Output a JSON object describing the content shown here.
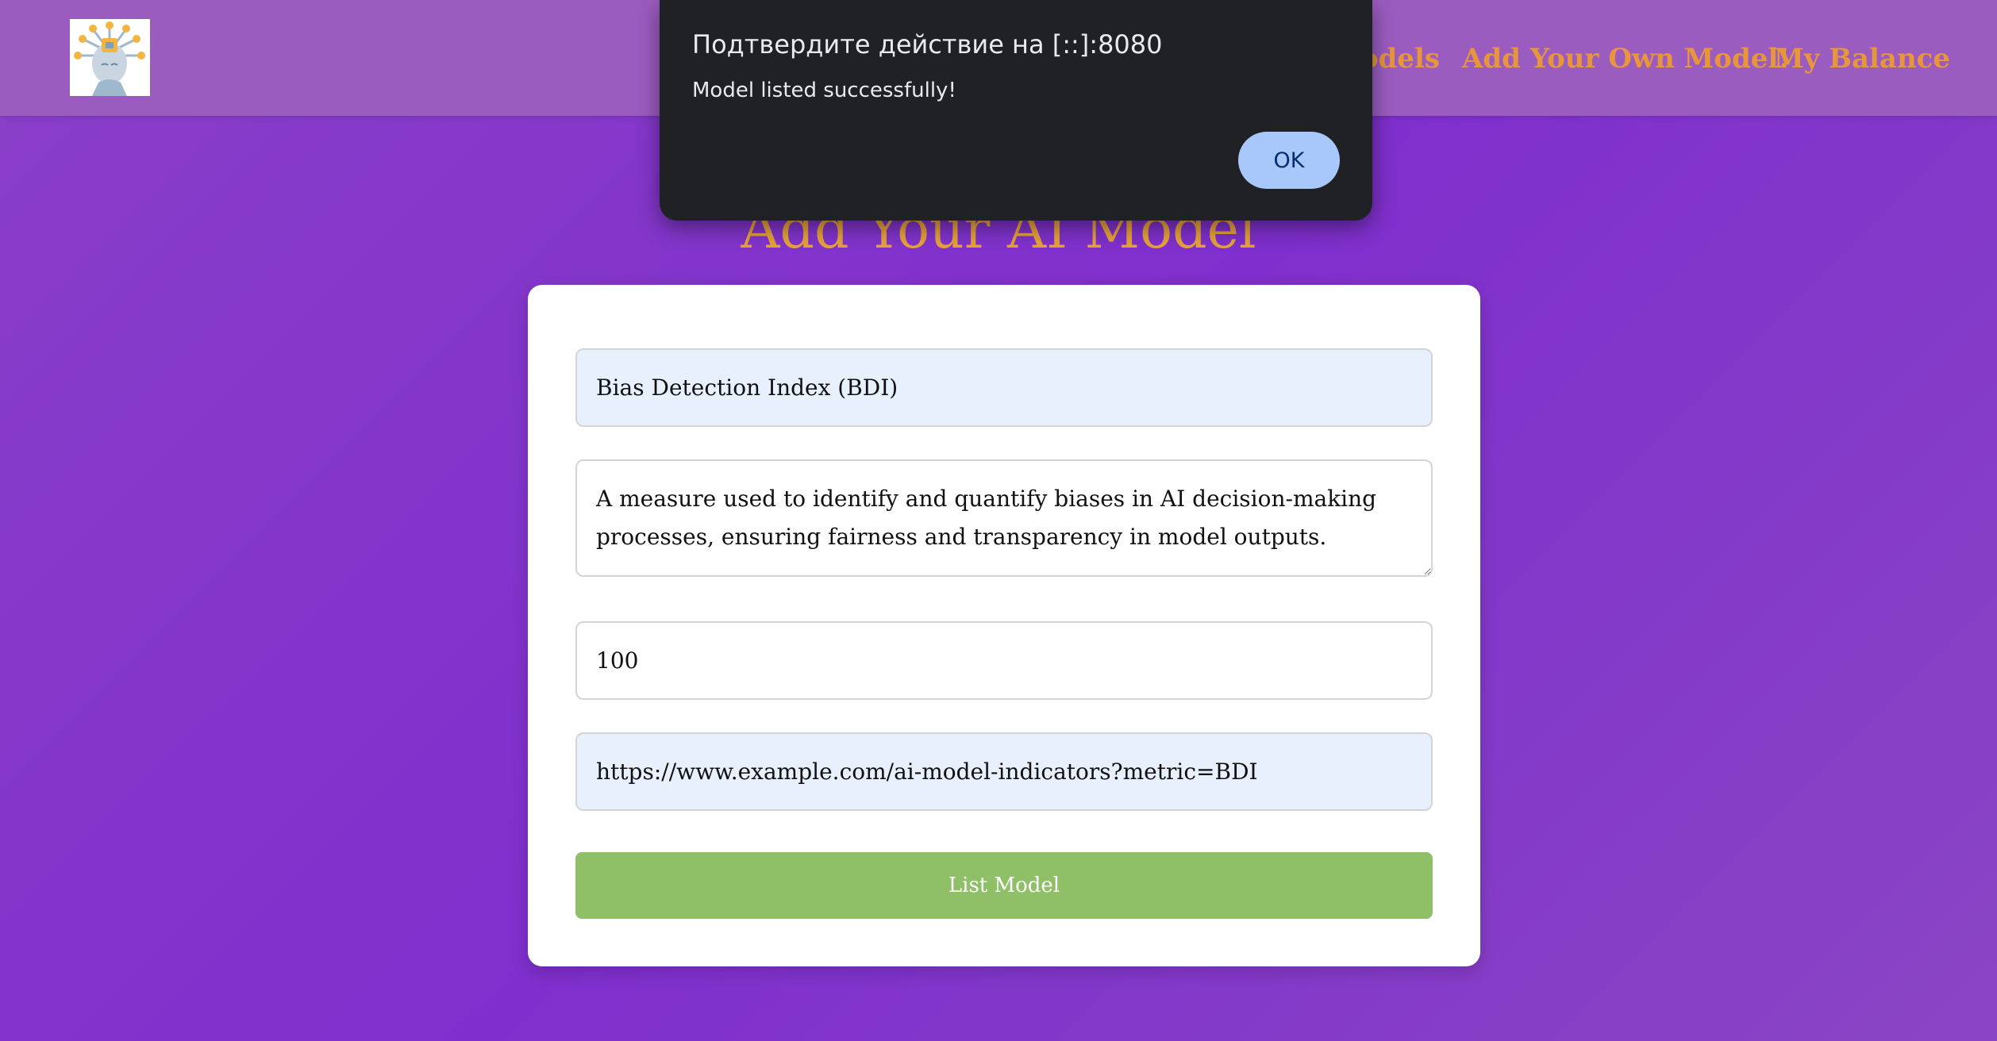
{
  "header": {
    "logo_icon": "ai-robot-head-icon",
    "nav": {
      "models_label": "odels",
      "add_model_label": "Add Your Own Model!",
      "balance_label": "My Balance"
    }
  },
  "main": {
    "title": "Add Your AI Model",
    "form": {
      "name_value": "Bias Detection Index (BDI)",
      "description_value": "A measure used to identify and quantify biases in AI decision-making processes, ensuring fairness and transparency in model outputs.",
      "price_value": "100",
      "url_value": "https://www.example.com/ai-model-indicators?metric=BDI",
      "submit_label": "List Model"
    }
  },
  "dialog": {
    "title": "Подтвердите действие на [::]:8080",
    "message": "Model listed successfully!",
    "ok_label": "OK"
  },
  "colors": {
    "background": "#7f2fcd",
    "header": "#9b5cc0",
    "accent": "#e8963c",
    "button": "#8fc068",
    "dialog": "#202124",
    "dialog_button": "#a8c7fa"
  }
}
